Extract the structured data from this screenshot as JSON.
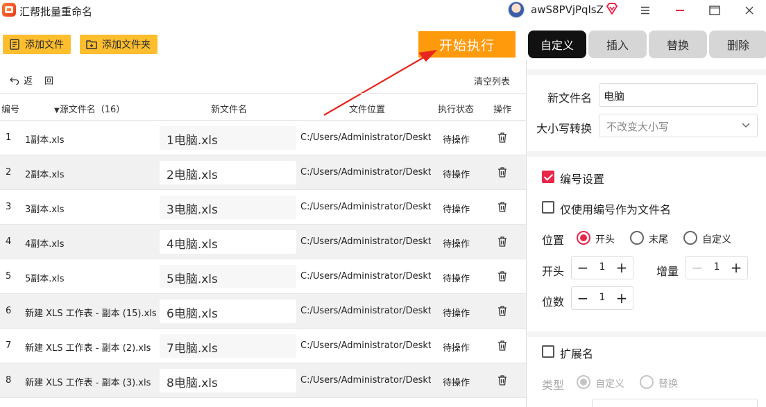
{
  "app": {
    "title": "汇帮批量重命名",
    "username": "awS8PVjPqlsZ"
  },
  "toolbar": {
    "add_file": "添加文件",
    "add_folder": "添加文件夹",
    "start": "开始执行",
    "undo": "返",
    "redo": "回",
    "clear": "清空列表"
  },
  "table": {
    "headers": {
      "index": "编号",
      "source": "源文件名（16）",
      "newname": "新文件名",
      "location": "文件位置",
      "status": "执行状态",
      "action": "操作"
    },
    "rows": [
      {
        "index": "1",
        "source": "1副本.xls",
        "newname": "1电脑.xls",
        "location": "C:/Users/Administrator/Desktop/",
        "status": "待操作"
      },
      {
        "index": "2",
        "source": "2副本.xls",
        "newname": "2电脑.xls",
        "location": "C:/Users/Administrator/Desktop/",
        "status": "待操作"
      },
      {
        "index": "3",
        "source": "3副本.xls",
        "newname": "3电脑.xls",
        "location": "C:/Users/Administrator/Desktop/",
        "status": "待操作"
      },
      {
        "index": "4",
        "source": "4副本.xls",
        "newname": "4电脑.xls",
        "location": "C:/Users/Administrator/Desktop/",
        "status": "待操作"
      },
      {
        "index": "5",
        "source": "5副本.xls",
        "newname": "5电脑.xls",
        "location": "C:/Users/Administrator/Desktop/",
        "status": "待操作"
      },
      {
        "index": "6",
        "source": "新建 XLS 工作表 - 副本 (15).xls",
        "newname": "6电脑.xls",
        "location": "C:/Users/Administrator/Desktop/",
        "status": "待操作"
      },
      {
        "index": "7",
        "source": "新建 XLS 工作表 - 副本 (2).xls",
        "newname": "7电脑.xls",
        "location": "C:/Users/Administrator/Desktop/",
        "status": "待操作"
      },
      {
        "index": "8",
        "source": "新建 XLS 工作表 - 副本 (3).xls",
        "newname": "8电脑.xls",
        "location": "C:/Users/Administrator/Desktop/",
        "status": "待操作"
      }
    ]
  },
  "tabs": [
    "自定义",
    "插入",
    "替换",
    "删除"
  ],
  "panel": {
    "newname_label": "新文件名",
    "newname_value": "电脑",
    "case_label": "大小写转换",
    "case_value": "不改变大小写",
    "numbering_label": "编号设置",
    "numbering_checked": true,
    "only_number_label": "仅使用编号作为文件名",
    "only_number_checked": false,
    "position_label": "位置",
    "position_options": [
      "开头",
      "末尾",
      "自定义"
    ],
    "position_selected": "开头",
    "start_label": "开头",
    "start_value": "1",
    "increment_label": "增量",
    "increment_value": "1",
    "digits_label": "位数",
    "digits_value": "1",
    "extension_label": "扩展名",
    "extension_checked": false,
    "type_label": "类型",
    "type_options": [
      "自定义",
      "替换"
    ],
    "type_selected": "自定义"
  },
  "colors": {
    "accent": "#e8264a",
    "start_button": "#ff9a0d",
    "toolbar_button": "#ffbe2e",
    "active_tab": "#111111"
  }
}
